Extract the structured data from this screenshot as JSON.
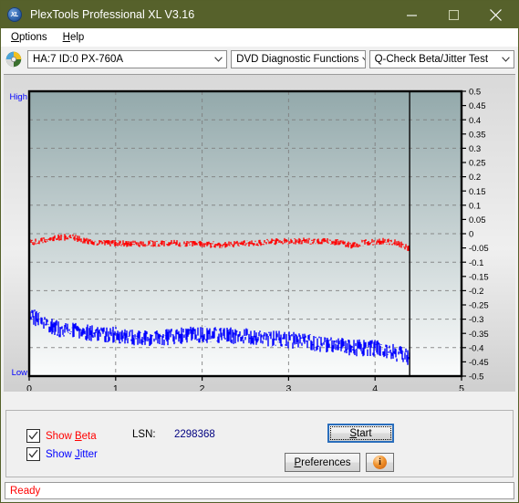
{
  "window": {
    "title": "PlexTools Professional XL V3.16",
    "app_icon": "xl-disc-icon",
    "icon_text": "XL",
    "titlebar_color": "#56612b",
    "minimize": "minimize-icon",
    "maximize": "maximize-icon",
    "close": "close-icon"
  },
  "menubar": {
    "items": [
      {
        "label": "Options",
        "accel": "O"
      },
      {
        "label": "Help",
        "accel": "H"
      }
    ]
  },
  "toolbar": {
    "drive_icon": "disc-icon",
    "drive_combo": {
      "value": "HA:7 ID:0  PX-760A",
      "options": [
        "HA:7 ID:0  PX-760A"
      ]
    },
    "function_combo": {
      "value": "DVD Diagnostic Functions",
      "options": [
        "DVD Diagnostic Functions"
      ]
    },
    "test_combo": {
      "value": "Q-Check Beta/Jitter Test",
      "options": [
        "Q-Check Beta/Jitter Test"
      ]
    }
  },
  "controls": {
    "show_beta": {
      "label_prefix": "Show ",
      "label_accel": "B",
      "label_suffix": "eta",
      "checked": true,
      "color": "#ff0000"
    },
    "show_jitter": {
      "label_prefix": "Show ",
      "label_accel": "J",
      "label_suffix": "itter",
      "checked": true,
      "color": "#0000ff"
    },
    "lsn_label": "LSN:",
    "lsn_value": "2298368",
    "start_button": {
      "prefix": "",
      "accel": "S",
      "suffix": "tart"
    },
    "preferences_button": {
      "prefix": "",
      "accel": "P",
      "suffix": "references"
    },
    "info_button": {
      "glyph": "i",
      "name": "info-icon"
    }
  },
  "statusbar": {
    "text": "Ready",
    "color": "#ff0000"
  },
  "chart_data": {
    "type": "line",
    "title": "",
    "xlabel": "",
    "ylabel": "",
    "xlim": [
      0,
      5
    ],
    "ylim": [
      -0.5,
      0.5
    ],
    "xticks": [
      0,
      1,
      2,
      3,
      4,
      5
    ],
    "xtick_labels": [
      "0",
      "1",
      "2",
      "3",
      "4",
      "5"
    ],
    "yticks": [
      0.5,
      0.45,
      0.4,
      0.35,
      0.3,
      0.25,
      0.2,
      0.15,
      0.1,
      0.05,
      0,
      -0.05,
      -0.1,
      -0.15,
      -0.2,
      -0.25,
      -0.3,
      -0.35,
      -0.4,
      -0.45,
      -0.5
    ],
    "ytick_labels": [
      "0.5",
      "0.45",
      "0.4",
      "0.35",
      "0.3",
      "0.25",
      "0.2",
      "0.15",
      "0.1",
      "0.05",
      "0",
      "-0.05",
      "-0.1",
      "-0.15",
      "-0.2",
      "-0.25",
      "-0.3",
      "-0.35",
      "-0.4",
      "-0.45",
      "-0.5"
    ],
    "axis_left_label": "High",
    "axis_left_label_bottom": "Low",
    "grid": true,
    "grid_style": "dashed",
    "grid_color": "#7d7d7d",
    "plot_bg_top": "#93a9ab",
    "plot_bg_bottom": "#fbfcfc",
    "data_end_x": 4.4,
    "data_end_marker": true,
    "legend": [
      "Show Beta",
      "Show Jitter"
    ],
    "legend_position": "below-plot",
    "series": [
      {
        "name": "Beta",
        "color": "#ff0000",
        "noise_amplitude": 0.012,
        "x": [
          0.0,
          0.11,
          0.22,
          0.33,
          0.44,
          0.55,
          0.66,
          0.77,
          0.88,
          1.0,
          1.1,
          1.21,
          1.32,
          1.43,
          1.54,
          1.65,
          1.76,
          1.87,
          1.98,
          2.09,
          2.2,
          2.31,
          2.42,
          2.53,
          2.64,
          2.75,
          2.86,
          2.97,
          3.08,
          3.19,
          3.3,
          3.41,
          3.52,
          3.63,
          3.74,
          3.85,
          3.96,
          4.07,
          4.1,
          4.15,
          4.22,
          4.3,
          4.36,
          4.4
        ],
        "values": [
          -0.03,
          -0.028,
          -0.02,
          -0.014,
          -0.012,
          -0.016,
          -0.026,
          -0.031,
          -0.033,
          -0.034,
          -0.035,
          -0.036,
          -0.036,
          -0.035,
          -0.035,
          -0.034,
          -0.034,
          -0.035,
          -0.036,
          -0.038,
          -0.039,
          -0.038,
          -0.036,
          -0.034,
          -0.032,
          -0.03,
          -0.028,
          -0.027,
          -0.026,
          -0.026,
          -0.026,
          -0.027,
          -0.029,
          -0.033,
          -0.041,
          -0.033,
          -0.029,
          -0.028,
          -0.026,
          -0.027,
          -0.031,
          -0.038,
          -0.046,
          -0.056
        ]
      },
      {
        "name": "Jitter",
        "color": "#0000ff",
        "noise_amplitude": 0.03,
        "x": [
          0.0,
          0.05,
          0.11,
          0.17,
          0.22,
          0.28,
          0.33,
          0.44,
          0.55,
          0.66,
          0.77,
          0.88,
          1.0,
          1.1,
          1.21,
          1.32,
          1.43,
          1.54,
          1.65,
          1.76,
          1.87,
          1.98,
          2.09,
          2.2,
          2.31,
          2.42,
          2.53,
          2.64,
          2.75,
          2.86,
          2.97,
          3.08,
          3.19,
          3.3,
          3.41,
          3.52,
          3.63,
          3.74,
          3.85,
          3.96,
          4.07,
          4.18,
          4.29,
          4.4
        ],
        "values": [
          -0.275,
          -0.29,
          -0.305,
          -0.315,
          -0.322,
          -0.328,
          -0.332,
          -0.338,
          -0.343,
          -0.346,
          -0.349,
          -0.352,
          -0.356,
          -0.36,
          -0.366,
          -0.37,
          -0.368,
          -0.364,
          -0.36,
          -0.357,
          -0.356,
          -0.355,
          -0.356,
          -0.357,
          -0.358,
          -0.36,
          -0.362,
          -0.364,
          -0.366,
          -0.369,
          -0.372,
          -0.376,
          -0.38,
          -0.384,
          -0.388,
          -0.392,
          -0.396,
          -0.399,
          -0.402,
          -0.401,
          -0.406,
          -0.414,
          -0.424,
          -0.436
        ]
      }
    ]
  }
}
